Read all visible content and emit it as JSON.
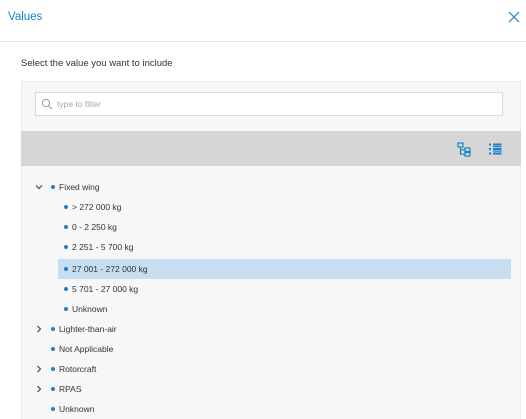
{
  "dialog": {
    "title": "Values",
    "instruction": "Select the value you want to include",
    "filter_placeholder": "type to filter"
  },
  "icons": {
    "close": "close-icon",
    "search": "search-icon",
    "tree_view": "tree-view-icon",
    "list_view": "list-view-icon",
    "expanded": "chevron-down-icon",
    "collapsed": "chevron-right-icon"
  },
  "colors": {
    "accent": "#1a82c8",
    "toolbar": "#d6d6d6",
    "selected_row": "#c7def2"
  },
  "tree": {
    "n0": {
      "label": "Fixed wing",
      "expanded": true
    },
    "n1": {
      "label": "> 272 000 kg"
    },
    "n2": {
      "label": "0 - 2 250 kg"
    },
    "n3": {
      "label": "2 251 - 5 700 kg"
    },
    "n4": {
      "label": "27 001 - 272 000 kg",
      "selected": true
    },
    "n5": {
      "label": "5 701 - 27 000 kg"
    },
    "n6": {
      "label": "Unknown"
    },
    "n7": {
      "label": "Lighter-than-air",
      "expanded": false
    },
    "n8": {
      "label": "Not Applicable"
    },
    "n9": {
      "label": "Rotorcraft",
      "expanded": false
    },
    "n10": {
      "label": "RPAS",
      "expanded": false
    },
    "n11": {
      "label": "Unknown"
    }
  }
}
